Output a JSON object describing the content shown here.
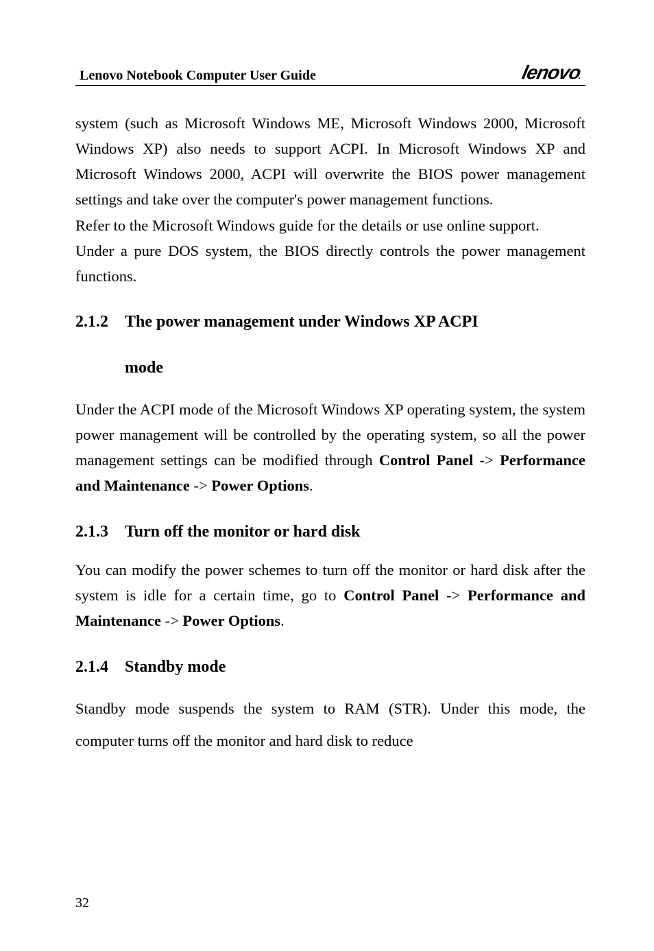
{
  "header": {
    "title": "Lenovo Notebook Computer User Guide",
    "brand": "lenovo",
    "brand_dot": "."
  },
  "para1": "system (such as Microsoft Windows ME, Microsoft Windows 2000, Microsoft Windows XP) also needs to support ACPI. In Microsoft Windows XP and Microsoft Windows 2000, ACPI will overwrite the BIOS power management settings and take over the computer's power management functions.",
  "para2": "Refer to the Microsoft Windows guide for the details or use online support.",
  "para3": "Under a pure DOS system, the BIOS directly controls the power management functions.",
  "sec212": {
    "num": "2.1.2",
    "title_line1": "The power management under Windows XP ACPI",
    "title_line2": "mode"
  },
  "para4a": "Under the ACPI mode of the Microsoft Windows XP operating system, the system power management will be controlled by the operating system, so all the power management settings can be modified through ",
  "para4b": "Control Panel",
  "para4c": " -> ",
  "para4d": "Performance and Maintenance",
  "para4e": " -> ",
  "para4f": "Power Options",
  "para4g": ".",
  "sec213": {
    "num": "2.1.3",
    "title": "Turn off the monitor or hard disk"
  },
  "para5a": "You can modify the power schemes to turn off the monitor or hard disk after the system is idle for a certain time, go to ",
  "para5b": "Control Panel",
  "para5c": " -> ",
  "para5d": "Performance and Maintenance",
  "para5e": " -> ",
  "para5f": "Power Options",
  "para5g": ".",
  "sec214": {
    "num": "2.1.4",
    "title": "Standby mode"
  },
  "para6": "Standby mode suspends the system to RAM (STR). Under this mode, the computer turns off the monitor and hard disk to reduce",
  "page_number": "32"
}
